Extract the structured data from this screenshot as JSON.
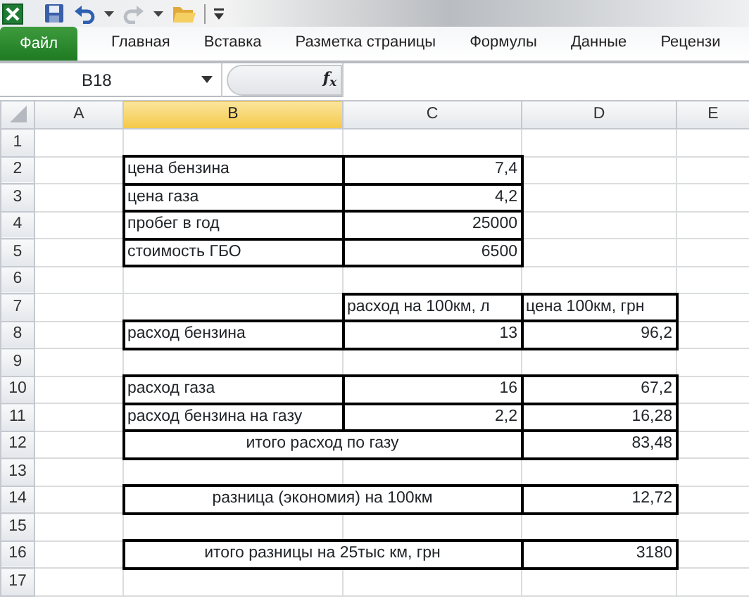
{
  "quick_access": [
    {
      "kind": "app"
    },
    {
      "kind": "save"
    },
    {
      "kind": "undo"
    },
    {
      "kind": "menu"
    },
    {
      "kind": "redo",
      "disabled": true
    },
    {
      "kind": "menu"
    },
    {
      "kind": "open"
    },
    {
      "kind": "sep"
    },
    {
      "kind": "customize"
    }
  ],
  "ribbon_tabs": [
    {
      "label": "Файл",
      "kind": "file"
    },
    {
      "label": "Главная",
      "kind": "tab"
    },
    {
      "label": "Вставка",
      "kind": "tab"
    },
    {
      "label": "Разметка страницы",
      "kind": "tab"
    },
    {
      "label": "Формулы",
      "kind": "tab"
    },
    {
      "label": "Данные",
      "kind": "tab"
    },
    {
      "label": "Рецензи",
      "kind": "tab"
    }
  ],
  "name_box": "B18",
  "function_label": "f$_{x}$",
  "columns": [
    {
      "label": "A",
      "selected": false
    },
    {
      "label": "B",
      "selected": true
    },
    {
      "label": "C",
      "selected": false
    },
    {
      "label": "D",
      "selected": false
    },
    {
      "label": "E",
      "selected": false
    }
  ],
  "rows": [
    {
      "number": "1",
      "kind": "empty"
    },
    {
      "number": "2",
      "kind": "input",
      "label": "цена бензина",
      "value": "7,4"
    },
    {
      "number": "3",
      "kind": "input",
      "label": "цена газа",
      "value": "4,2"
    },
    {
      "number": "4",
      "kind": "input",
      "label": "пробег в год",
      "value": "25000"
    },
    {
      "number": "5",
      "kind": "input",
      "label": "стоимость ГБО",
      "value": "6500"
    },
    {
      "number": "6",
      "kind": "empty"
    },
    {
      "number": "7",
      "kind": "header",
      "headers": [
        "расход на 100км, л",
        "цена 100км, грн"
      ]
    },
    {
      "number": "8",
      "kind": "calc",
      "label": "расход бензина",
      "value": "13",
      "cost": "96,2"
    },
    {
      "number": "9",
      "kind": "empty"
    },
    {
      "number": "10",
      "kind": "calc",
      "label": "расход газа",
      "value": "16",
      "cost": "67,2"
    },
    {
      "number": "11",
      "kind": "calc",
      "label": "расход бензина на газу",
      "value": "2,2",
      "cost": "16,28"
    },
    {
      "number": "12",
      "kind": "total",
      "label": "итого расход по газу",
      "cost": "83,48"
    },
    {
      "number": "13",
      "kind": "empty"
    },
    {
      "number": "14",
      "kind": "total",
      "label": "разница (экономия) на 100км",
      "cost": "12,72"
    },
    {
      "number": "15",
      "kind": "empty"
    },
    {
      "number": "16",
      "kind": "total",
      "label": "итого разницы на 25тыс км, грн",
      "cost": "3180"
    },
    {
      "number": "17",
      "kind": "empty"
    }
  ]
}
